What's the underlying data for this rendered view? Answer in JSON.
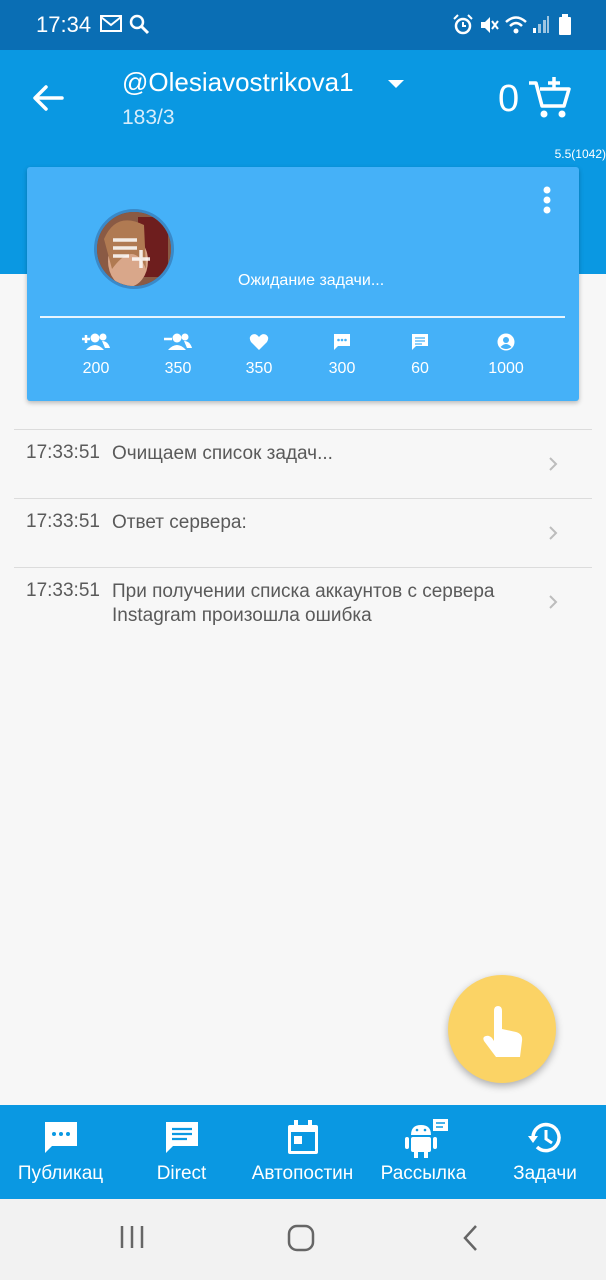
{
  "status_bar": {
    "time": "17:34"
  },
  "app_bar": {
    "account": "@Olesiavostrikova1",
    "counts": "183/3",
    "cart_count": "0",
    "version": "5.5(1042)"
  },
  "card": {
    "status_text": "Ожидание задачи...",
    "stats": [
      {
        "icon": "follow-icon",
        "value": "200"
      },
      {
        "icon": "unfollow-icon",
        "value": "350"
      },
      {
        "icon": "heart-icon",
        "value": "350"
      },
      {
        "icon": "comment-icon",
        "value": "300"
      },
      {
        "icon": "message-icon",
        "value": "60"
      },
      {
        "icon": "account-icon",
        "value": "1000"
      }
    ]
  },
  "log": [
    {
      "time": "17:33:51",
      "message": "Очищаем список задач..."
    },
    {
      "time": "17:33:51",
      "message": "Ответ сервера:"
    },
    {
      "time": "17:33:51",
      "message": "При получении списка аккаунтов с сервера Instagram произошла ошибка"
    }
  ],
  "bottom_nav": [
    {
      "label": "Публикац",
      "icon": "publication-icon"
    },
    {
      "label": "Direct",
      "icon": "direct-icon"
    },
    {
      "label": "Автопостин",
      "icon": "calendar-icon"
    },
    {
      "label": "Рассылка",
      "icon": "android-icon"
    },
    {
      "label": "Задачи",
      "icon": "history-icon"
    }
  ],
  "colors": {
    "status_bar": "#0a6eb4",
    "app_bar": "#0a98e2",
    "card": "#45b1f8",
    "fab": "#fbd365"
  }
}
